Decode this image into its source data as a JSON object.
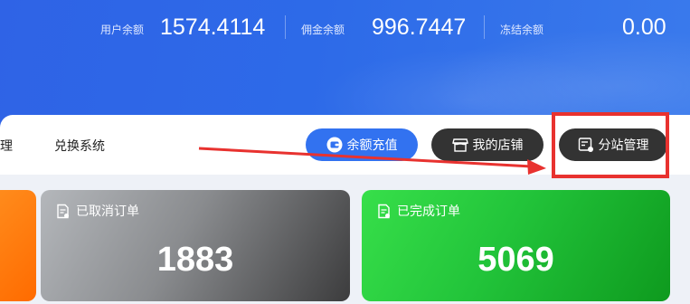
{
  "balances": {
    "user": {
      "label": "用户余额",
      "value": "1574.4114"
    },
    "commission": {
      "label": "佣金余额",
      "value": "996.7447"
    },
    "frozen": {
      "label": "冻结余额",
      "value": "0.00"
    }
  },
  "nav": {
    "clipped_text": "理",
    "exchange": "兑换系统"
  },
  "actions": {
    "recharge": "余额充值",
    "my_shop": "我的店铺",
    "substation": "分站管理"
  },
  "stats": {
    "cancelled": {
      "label": "已取消订单",
      "value": "1883"
    },
    "completed": {
      "label": "已完成订单",
      "value": "5069"
    }
  },
  "colors": {
    "header_blue": "#2f63e6",
    "recharge_blue": "#3272f0",
    "dark_button": "#333333",
    "annotation_red": "#e8322f",
    "green_card": "#22c43a"
  },
  "icons": {
    "recharge": "wallet-icon",
    "shop": "storefront-icon",
    "substation": "site-settings-icon",
    "order": "document-icon"
  }
}
